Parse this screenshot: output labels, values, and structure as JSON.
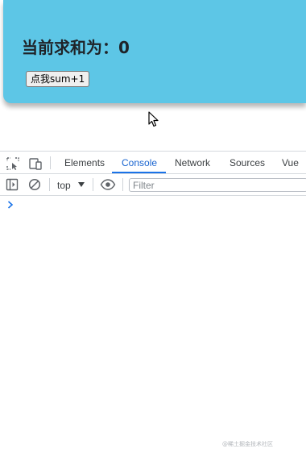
{
  "app": {
    "sum_title": "当前求和为：0",
    "increment_button": "点我sum+1"
  },
  "devtools": {
    "tabs": [
      {
        "label": "Elements"
      },
      {
        "label": "Console",
        "active": true
      },
      {
        "label": "Network"
      },
      {
        "label": "Sources"
      },
      {
        "label": "Vue"
      }
    ],
    "console": {
      "context": "top",
      "filter_placeholder": "Filter"
    }
  },
  "watermark": "@稀土掘金技术社区",
  "colors": {
    "app_background": "#5dc6e6",
    "active_tab": "#1a73e8"
  }
}
